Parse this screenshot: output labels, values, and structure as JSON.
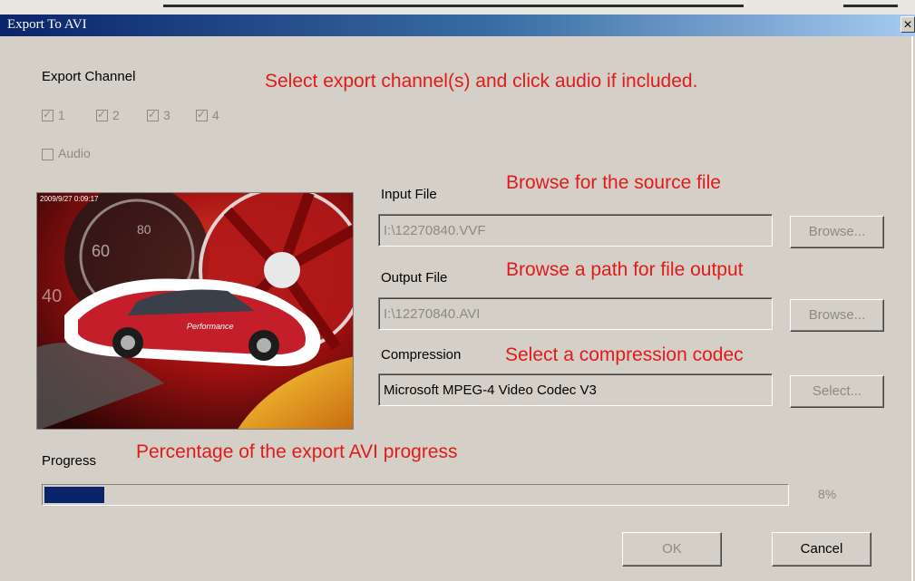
{
  "window": {
    "title": "Export To AVI",
    "close_glyph": "×"
  },
  "export_channel": {
    "label": "Export Channel",
    "channels": [
      {
        "label": "1",
        "checked": true
      },
      {
        "label": "2",
        "checked": true
      },
      {
        "label": "3",
        "checked": true
      },
      {
        "label": "4",
        "checked": true
      }
    ],
    "audio": {
      "label": "Audio",
      "checked": false
    }
  },
  "preview": {
    "timestamp": "2009/9/27 0:09:17",
    "icon": "video-preview-image"
  },
  "input_file": {
    "label": "Input File",
    "value": "I:\\12270840.VVF",
    "browse_label": "Browse..."
  },
  "output_file": {
    "label": "Output File",
    "value": "I:\\12270840.AVI",
    "browse_label": "Browse..."
  },
  "compression": {
    "label": "Compression",
    "value": "Microsoft MPEG-4 Video Codec V3",
    "select_label": "Select..."
  },
  "progress": {
    "label": "Progress",
    "percent": 8,
    "text": "8%"
  },
  "buttons": {
    "ok": "OK",
    "cancel": "Cancel"
  },
  "annotations": {
    "channel_hint": "Select export channel(s) and click audio if included.",
    "input_hint": "Browse for the source file",
    "output_hint": "Browse a path for file output",
    "compression_hint": "Select a compression codec",
    "progress_hint": "Percentage of the export AVI progress"
  },
  "colors": {
    "title_start": "#0a246a",
    "title_end": "#a6caf0",
    "annotation": "#e01a1a",
    "progress_fill": "#0a246a",
    "dialog_bg": "#d4d0c8"
  }
}
